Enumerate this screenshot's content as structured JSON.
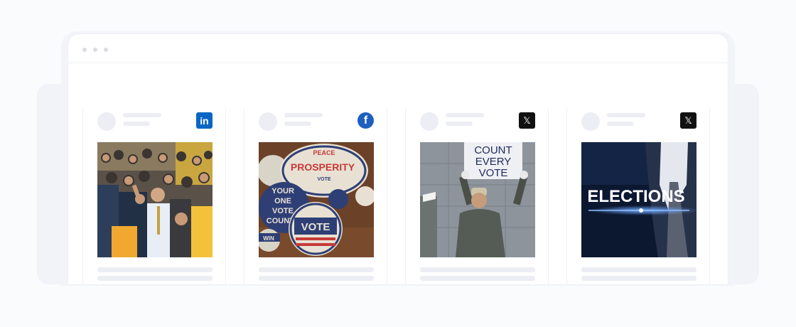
{
  "window": {
    "dots": [
      "dot-1",
      "dot-2",
      "dot-3"
    ]
  },
  "cards": [
    {
      "network": "LinkedIn",
      "icon": "linkedin-icon",
      "icon_text": "in",
      "color": "#0a66c2",
      "photo": "crowd-rally-photo"
    },
    {
      "network": "Facebook",
      "icon": "facebook-icon",
      "icon_text": "f",
      "color": "#1f5fbf",
      "photo": "vote-buttons-photo",
      "photo_text": {
        "badge1": "PEACE",
        "badge1b": "PROSPERITY",
        "badge1c": "VOTE",
        "badge2a": "YOUR",
        "badge2b": "ONE",
        "badge2c": "VOTE",
        "badge2d": "COUNTS",
        "badge3": "VOTE",
        "badge4": "WIN"
      }
    },
    {
      "network": "X",
      "icon": "x-icon",
      "icon_text": "𝕏",
      "color": "#111111",
      "photo": "protester-photo",
      "photo_text": {
        "sign1": "COUNT",
        "sign2": "EVERY",
        "sign3": "VOTE"
      }
    },
    {
      "network": "X",
      "icon": "x-icon",
      "icon_text": "𝕏",
      "color": "#111111",
      "photo": "elections-banner-photo",
      "photo_text": {
        "banner": "ELECTIONS"
      }
    }
  ]
}
